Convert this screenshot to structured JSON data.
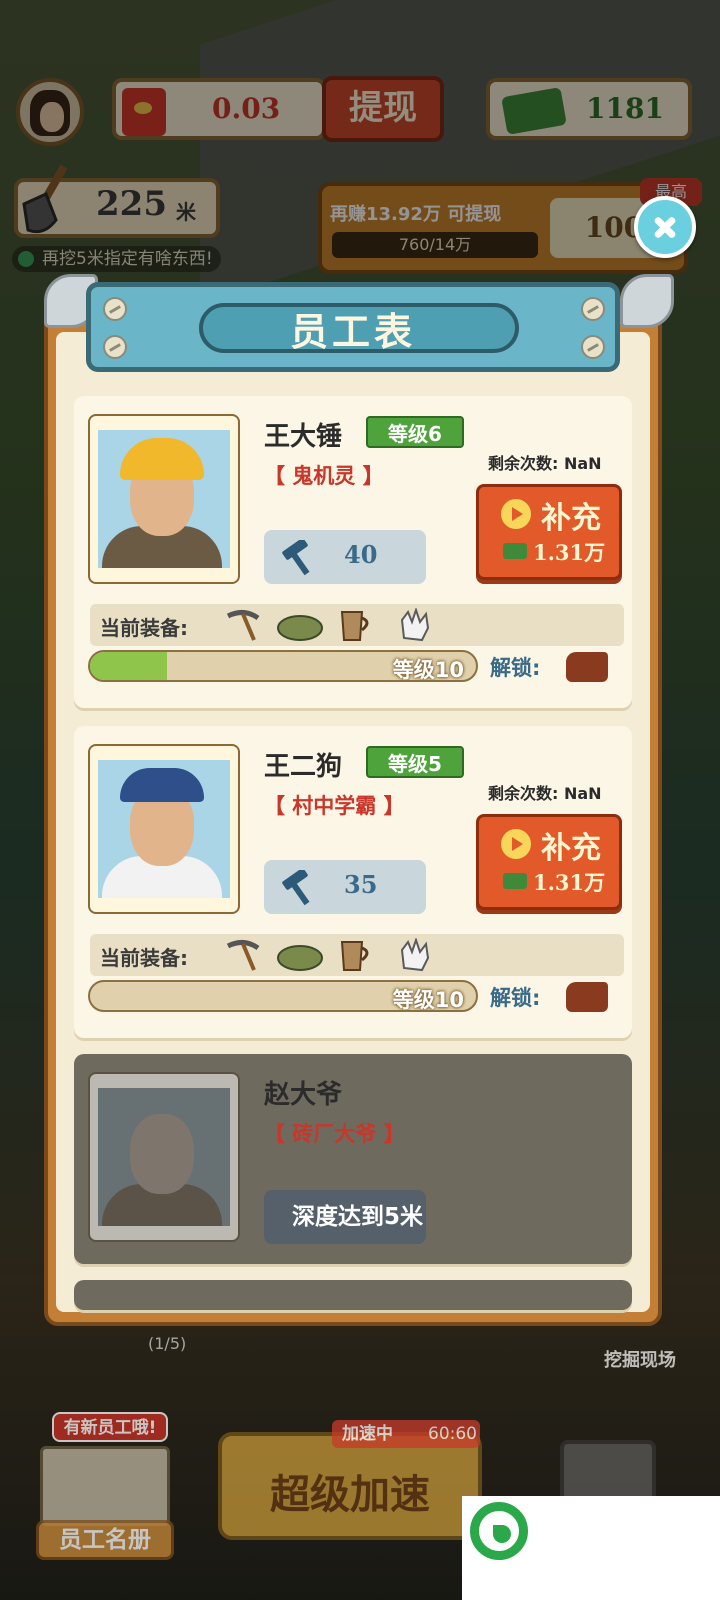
{
  "top_hud": {
    "red_packet_value": "0.03",
    "withdraw_label": "提现",
    "cash_value": "1181",
    "depth_value": "225",
    "depth_unit": "米",
    "hint_text": "再挖5米指定有啥东西!",
    "earn_text": "再赚13.92万",
    "earn_suffix": "可提现",
    "earn_progress": "760/14万",
    "earn_right_value": "100",
    "badge": "最高"
  },
  "panel": {
    "title": "员工表"
  },
  "employees": [
    {
      "name": "王大锤",
      "level": "等级6",
      "trait": "【 鬼机灵 】",
      "power": "40",
      "remaining": "剩余次数: NaN",
      "refill_label": "补充",
      "refill_cost": "1.31万",
      "equip_label": "当前装备:",
      "progress_label": "等级10",
      "progress_fraction": 0.2,
      "unlock_label": "解锁:",
      "hat_color": "#f0b82a",
      "body_color": "#6b5a44"
    },
    {
      "name": "王二狗",
      "level": "等级5",
      "trait": "【 村中学霸 】",
      "power": "35",
      "remaining": "剩余次数: NaN",
      "refill_label": "补充",
      "refill_cost": "1.31万",
      "equip_label": "当前装备:",
      "progress_label": "等级10",
      "progress_fraction": 0.0,
      "unlock_label": "解锁:",
      "hat_color": "#2e4f8a",
      "body_color": "#f2f2f2"
    },
    {
      "name": "赵大爷",
      "trait": "【 砖厂大爷 】",
      "lock_text": "深度达到5米"
    }
  ],
  "bottom_hud": {
    "new_employee_badge": "有新员工哦!",
    "roster_label": "员工名册",
    "page_indicator": "(1/5)",
    "speed_label": "超级加速",
    "speed_tag": "加速中",
    "speed_timer": "60:60",
    "dig_site_label": "挖掘现场"
  }
}
